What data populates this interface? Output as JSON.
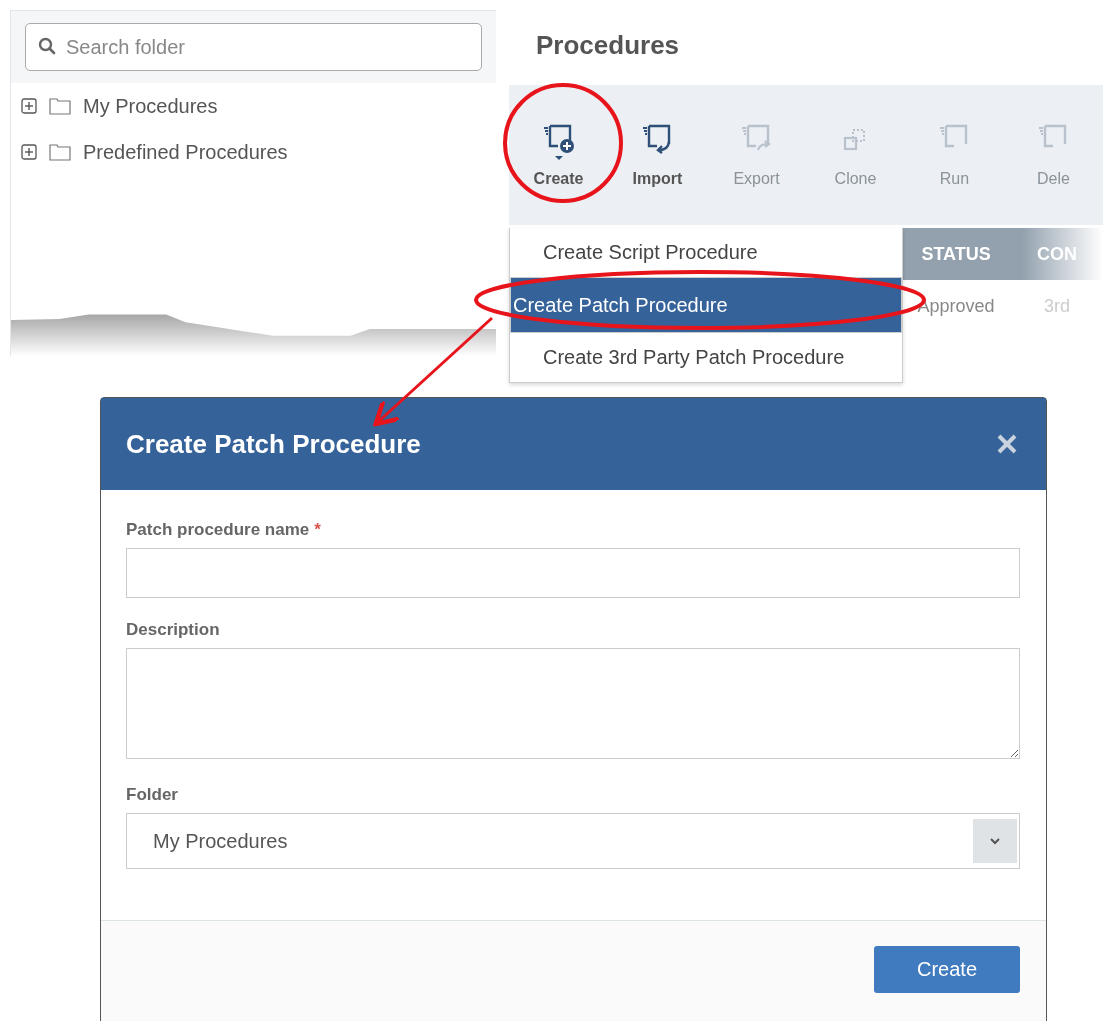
{
  "folder_panel": {
    "search": {
      "placeholder": "Search folder"
    },
    "tree": [
      {
        "label": "My Procedures",
        "expanded": false
      },
      {
        "label": "Predefined Procedures",
        "expanded": false
      }
    ]
  },
  "procedures_panel": {
    "title": "Procedures",
    "toolbar": [
      {
        "label": "Create",
        "kind": "create",
        "disabled": false
      },
      {
        "label": "Import",
        "kind": "import",
        "disabled": false
      },
      {
        "label": "Export",
        "kind": "export",
        "disabled": true
      },
      {
        "label": "Clone",
        "kind": "clone",
        "disabled": true
      },
      {
        "label": "Run",
        "kind": "run",
        "disabled": true
      },
      {
        "label": "Dele",
        "kind": "delete",
        "disabled": true
      }
    ],
    "create_menu": [
      {
        "label": "Create Script Procedure",
        "selected": false
      },
      {
        "label": "Create Patch Procedure",
        "selected": true
      },
      {
        "label": "Create 3rd Party Patch Procedure",
        "selected": false
      }
    ],
    "table": {
      "columns": [
        "STATUS",
        "CON"
      ],
      "rows": [
        [
          "Approved",
          "3rd"
        ]
      ]
    }
  },
  "dialog": {
    "title": "Create Patch Procedure",
    "fields": [
      {
        "label": "Patch procedure name",
        "required_mark": "*",
        "kind": "text"
      },
      {
        "label": "Description",
        "kind": "textarea"
      },
      {
        "label": "Folder",
        "kind": "select",
        "value": "My Procedures"
      }
    ],
    "buttons": [
      "Create"
    ]
  }
}
